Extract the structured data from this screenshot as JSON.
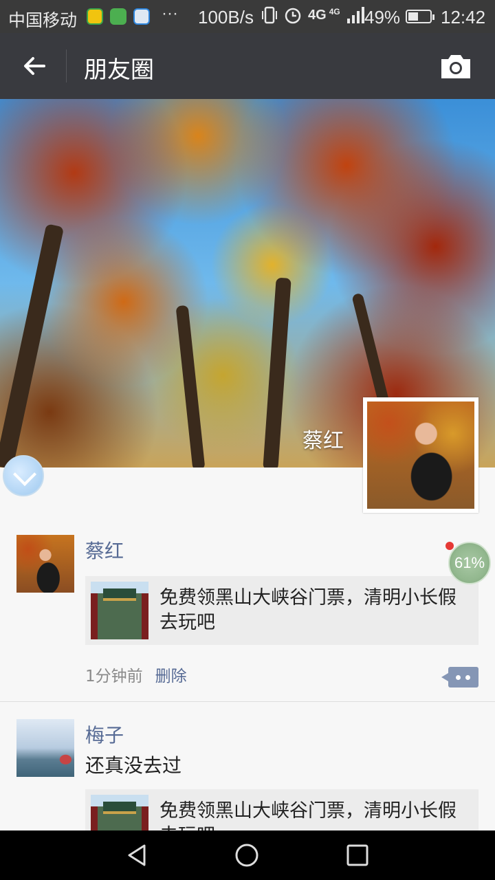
{
  "status_bar": {
    "carrier": "中国移动",
    "more": "···",
    "net_speed": "100B/s",
    "network": "4G",
    "network2": "4G",
    "battery": "49%",
    "time": "12:42"
  },
  "nav": {
    "title": "朋友圈",
    "back_icon": "arrow-left-icon",
    "camera_icon": "camera-icon"
  },
  "cover": {
    "name": "蔡红"
  },
  "posts": [
    {
      "username": "蔡红",
      "link_text": "免费领黑山大峡谷门票，清明小长假去玩吧",
      "time": "1分钟前",
      "delete_label": "删除"
    },
    {
      "username": "梅子",
      "text": "还真没去过",
      "link_text": "免费领黑山大峡谷门票，清明小长假去玩吧"
    }
  ],
  "floating_progress": "61%"
}
